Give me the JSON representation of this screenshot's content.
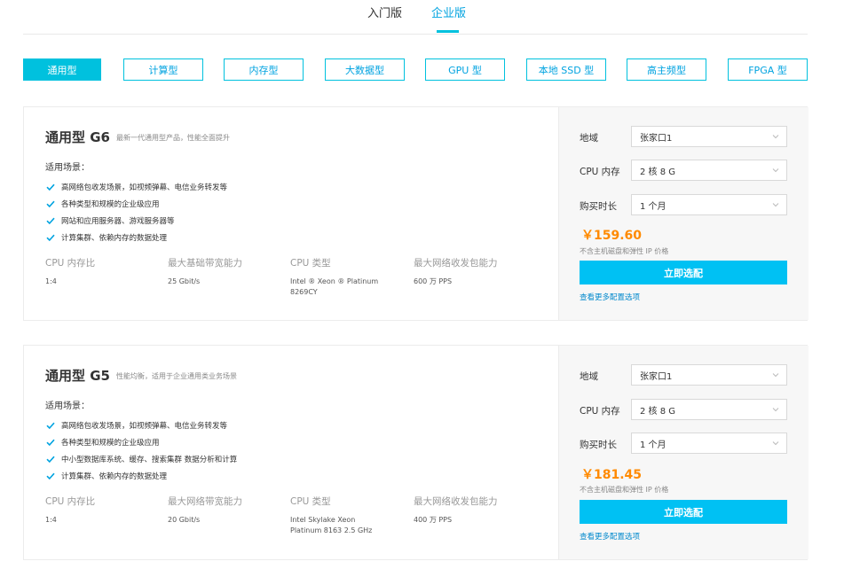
{
  "top_tabs": [
    {
      "label": "入门版"
    },
    {
      "label": "企业版"
    }
  ],
  "categories": [
    {
      "label": "通用型"
    },
    {
      "label": "计算型"
    },
    {
      "label": "内存型"
    },
    {
      "label": "大数据型"
    },
    {
      "label": "GPU 型"
    },
    {
      "label": "本地 SSD 型"
    },
    {
      "label": "高主频型"
    },
    {
      "label": "FPGA 型"
    }
  ],
  "products": [
    {
      "title": "通用型 G6",
      "subtitle": "最新一代通用型产品，性能全面提升",
      "scenario_title": "适用场景：",
      "scenarios": [
        "高网络包收发场景，如视频弹幕、电信业务转发等",
        "各种类型和规模的企业级应用",
        "网站和应用服务器、游戏服务器等",
        "计算集群、依赖内存的数据处理"
      ],
      "specs": [
        {
          "label": "CPU 内存比",
          "value": "1:4"
        },
        {
          "label": "最大基础带宽能力",
          "value": "25 Gbit/s"
        },
        {
          "label": "CPU 类型",
          "value": "Intel ® Xeon ® Platinum 8269CY"
        },
        {
          "label": "最大网络收发包能力",
          "value": "600 万 PPS"
        }
      ],
      "form": {
        "region_label": "地域",
        "region_value": "张家口1",
        "cpu_label": "CPU 内存",
        "cpu_value": "2 核 8 G",
        "duration_label": "购买时长",
        "duration_value": "1 个月"
      },
      "price": "￥159.60",
      "price_note": "不含主机磁盘和弹性 IP 价格",
      "buy_label": "立即选配",
      "more_label": "查看更多配置选项"
    },
    {
      "title": "通用型 G5",
      "subtitle": "性能均衡，适用于企业通用类业务场景",
      "scenario_title": "适用场景：",
      "scenarios": [
        "高网络包收发场景，如视频弹幕、电信业务转发等",
        "各种类型和规模的企业级应用",
        "中小型数据库系统、缓存、搜索集群 数据分析和计算",
        "计算集群、依赖内存的数据处理"
      ],
      "specs": [
        {
          "label": "CPU 内存比",
          "value": "1:4"
        },
        {
          "label": "最大网络带宽能力",
          "value": "20 Gbit/s"
        },
        {
          "label": "CPU 类型",
          "value": "Intel Skylake Xeon Platinum 8163 2.5 GHz"
        },
        {
          "label": "最大网络收发包能力",
          "value": "400 万 PPS"
        }
      ],
      "form": {
        "region_label": "地域",
        "region_value": "张家口1",
        "cpu_label": "CPU 内存",
        "cpu_value": "2 核 8 G",
        "duration_label": "购买时长",
        "duration_value": "1 个月"
      },
      "price": "￥181.45",
      "price_note": "不含主机磁盘和弹性 IP 价格",
      "buy_label": "立即选配",
      "more_label": "查看更多配置选项"
    }
  ],
  "colors": {
    "accent": "#00c1de",
    "price": "#ff8a00",
    "link": "#0088cc",
    "check": "#00a3e0"
  }
}
